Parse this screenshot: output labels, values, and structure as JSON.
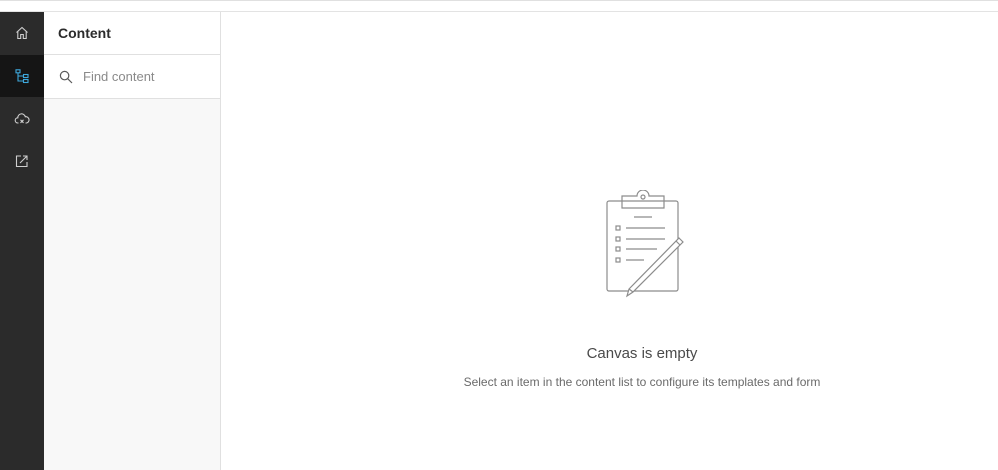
{
  "rail": {
    "items": [
      {
        "icon": "home-icon",
        "active": false
      },
      {
        "icon": "content-tree-icon",
        "active": true
      },
      {
        "icon": "cloud-icon",
        "active": false
      },
      {
        "icon": "export-icon",
        "active": false
      }
    ],
    "accent": "#3ea8dc"
  },
  "panel": {
    "title": "Content",
    "search": {
      "placeholder": "Find content",
      "value": ""
    }
  },
  "canvas": {
    "empty_icon": "clipboard-pencil-icon",
    "empty_title": "Canvas is empty",
    "empty_message": "Select an item in the content list to configure its templates and form"
  }
}
